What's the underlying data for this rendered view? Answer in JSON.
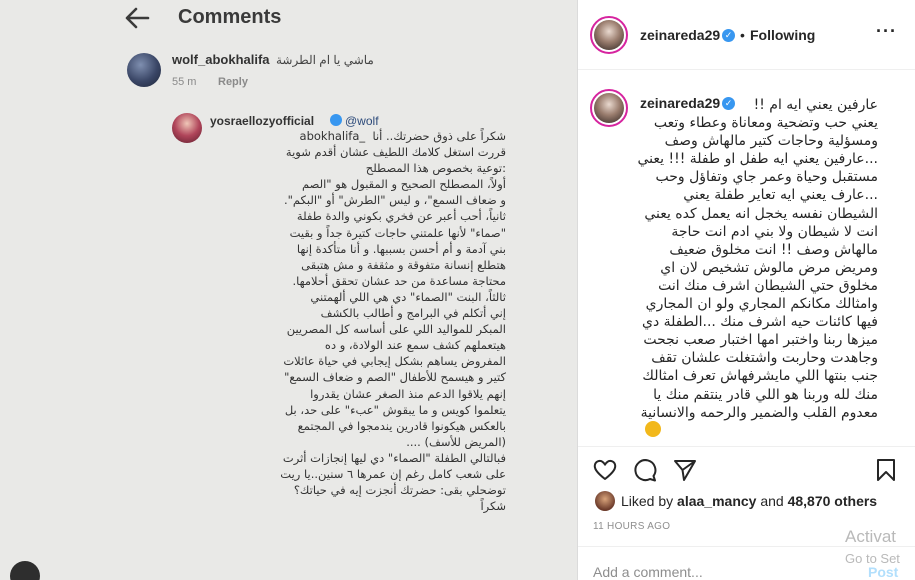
{
  "photo": {
    "header_title": "Comments",
    "comment1": {
      "username": "wolf_abokhalifa",
      "text": "ماشي يا ام الطرشة",
      "time": "55 m",
      "reply": "Reply"
    },
    "comment2": {
      "username": "yosraellozyofficial",
      "mention": "@wolf",
      "body": "شكراً على ذوق حضرتك.. أنا  _abokhalifa\nقررت استغل كلامك اللطيف عشان أقدم شوية\n:توعية بخصوص هذا المصطلح\nأولاً، المصطلح الصحيح و المقبول هو \"الصم\nو ضعاف السمع\"، و ليس \"الطرش\" أو \"البكم\".\nثانياً، أحب أعبر عن فخري بكوني والدة طفلة\n\"صماء\" لأنها علمتني حاجات كتيرة جداً و بقيت\nبني آدمة و أم أحسن بسببها. و أنا متأكدة إنها\nهتطلع إنسانة متفوقة و مثقفة و مش هتبقى\nمحتاجة مساعدة من حد عشان تحقق أحلامها.\nثالثاً، البنت \"الصماء\" دي هي اللي ألهمتني\nإني أتكلم في البرامج و أطالب بالكشف\nالمبكر للمواليد اللي على أساسه كل المصريين\nهيتعملهم كشف سمع عند الولادة، و ده\nالمفروض يساهم بشكل إيجابي في حياة عائلات\nكتير و هيسمح للأطفال \"الصم و ضعاف السمع\"\nإنهم يلاقوا الدعم منذ الصغر عشان يقدروا\nيتعلموا كويس و ما يبقوش \"عبء\" على حد، بل\nبالعكس هيكونوا قادرين يندمجوا في المجتمع\n(المريض للأسف) ....\nفبالتالي الطفلة \"الصماء\" دي ليها إنجازات أثرت\nعلى شعب كامل رغم إن عمرها ٦ سنين..يا ريت\nتوضحلي بقى: حضرتك أنجزت إيه في حياتك؟\nشكراً"
    }
  },
  "post": {
    "username": "zeinareda29",
    "follow_status": "Following",
    "caption": "عارفين يعني ايه ام !!\nيعني حب وتضحية ومعاناة وعطاء وتعب\nومسؤلية وحاجات كتير مالهاش وصف\n...عارفين يعني ايه طفل او طفلة !!! يعني\nمستقبل وحياة وعمر جاي وتفاؤل وحب\n...عارف يعني ايه تعاير طفلة يعني\nالشيطان نفسه يخجل انه يعمل كده يعني\nانت لا شيطان ولا بني ادم انت حاجة\nمالهاش وصف !! انت مخلوق ضعيف\nومريض مرض مالوش تشخيص لان اي\nمخلوق حتي الشيطان اشرف منك انت\nوامثالك مكانكم المجاري ولو ان المجاري\nفيها كائنات حيه اشرف منك ...الطفلة دي\nميزها ربنا واختبر امها اختبار صعب نجحت\nوجاهدت وحاربت واشتغلت علشان تقف\nجنب بنتها اللي مايشرفهاش تعرف امثالك\nمنك لله وربنا هو اللي قادر ينتقم منك يا\nمعدوم القلب والضمير والرحمه والانسانية",
    "liked_by_prefix": "Liked by",
    "liked_by_user": "alaa_mancy",
    "liked_by_and": "and",
    "likes_count": "48,870 others",
    "timestamp": "11 HOURS AGO",
    "add_comment_placeholder": "Add a comment...",
    "post_button": "Post"
  },
  "watermark": {
    "line1": "Activat",
    "line2": "Go to Set"
  },
  "colors": {
    "accent_blue": "#3897f0",
    "post_button_disabled": "#b2dffc",
    "story_ring": "#d6249f"
  }
}
